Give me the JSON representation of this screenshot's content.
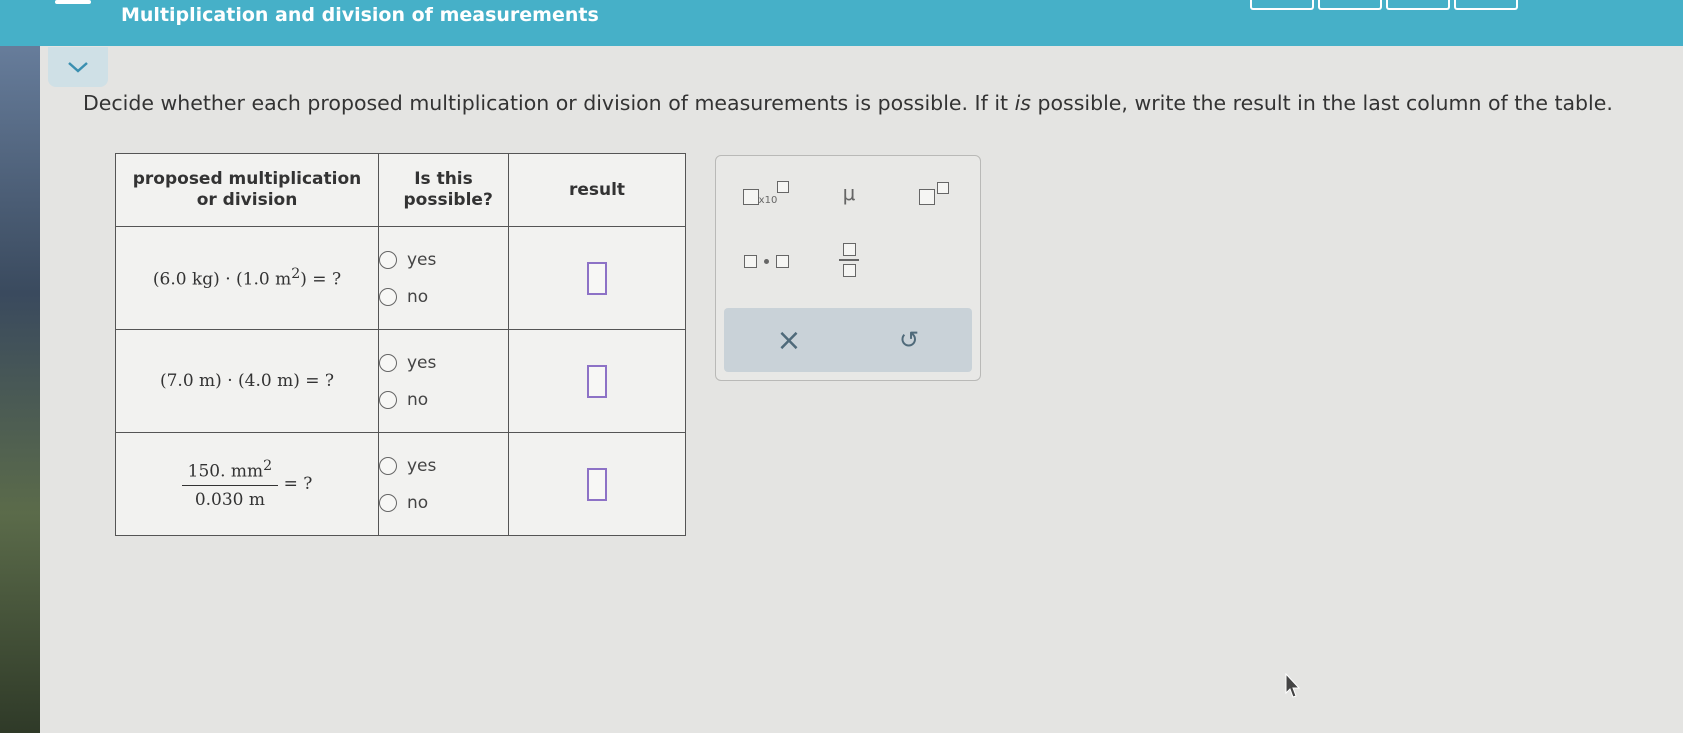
{
  "header": {
    "title": "Multiplication and division of measurements"
  },
  "instruction": {
    "before": "Decide whether each proposed multiplication or division of measurements is possible. If it ",
    "emphasis": "is",
    "after": " possible, write the result in the last column of the table."
  },
  "table": {
    "headers": {
      "col1": "proposed multiplication or division",
      "col2": "Is this possible?",
      "col3": "result"
    },
    "rows": [
      {
        "expr": {
          "a": "(6.0 kg)",
          "dot": "·",
          "b": "(1.0 m",
          "b_sup": "2",
          "b_close": ")",
          "tail": "= ?"
        },
        "yes": "yes",
        "no": "no"
      },
      {
        "expr": {
          "a": "(7.0 m)",
          "dot": "·",
          "b": "(4.0 m)",
          "tail": "= ?"
        },
        "yes": "yes",
        "no": "no"
      },
      {
        "expr": {
          "num": "150. mm",
          "num_sup": "2",
          "den": "0.030 m",
          "tail": "= ?"
        },
        "yes": "yes",
        "no": "no"
      }
    ]
  },
  "palette": {
    "x10": "x10",
    "mu": "μ",
    "clear": "×",
    "undo": "↺",
    "icons": [
      "sci-notation-icon",
      "mu-symbol",
      "superscript-icon",
      "multiply-dot-icon",
      "fraction-icon",
      "clear-icon",
      "undo-icon"
    ]
  },
  "colors": {
    "header": "#46b0c8",
    "answer_box_border": "#8d72c6"
  }
}
